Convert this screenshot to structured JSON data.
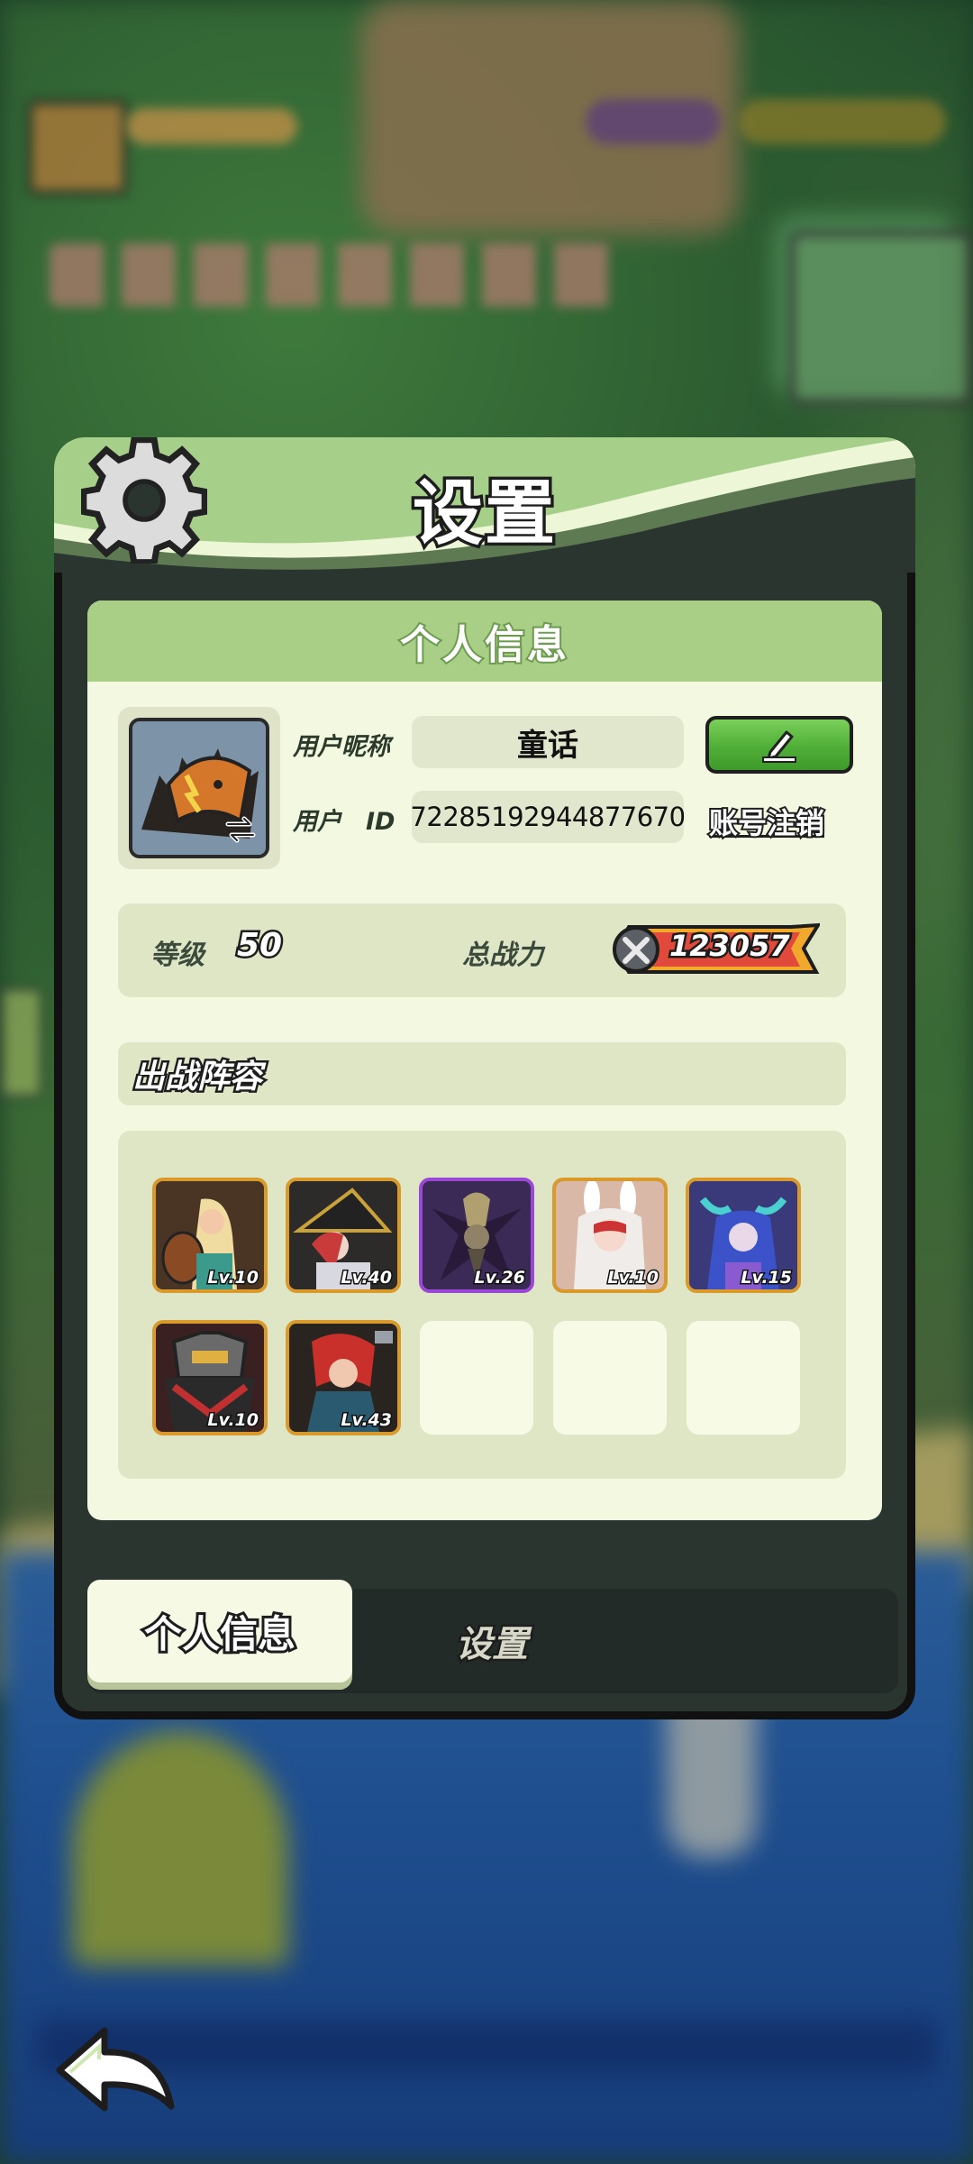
{
  "panel": {
    "title": "设置",
    "section_title": "个人信息"
  },
  "profile": {
    "nickname_label": "用户昵称",
    "nickname_value": "童话",
    "id_label": "用户　ID",
    "id_value": "72285192944877670",
    "edit_icon": "pencil-icon",
    "cancel_account_label": "账号注销"
  },
  "stats": {
    "level_label": "等级",
    "level_value": "50",
    "power_label": "总战力",
    "power_value": "123057"
  },
  "lineup": {
    "title": "出战阵容",
    "heroes": [
      {
        "level": "Lv.10"
      },
      {
        "level": "Lv.40"
      },
      {
        "level": "Lv.26"
      },
      {
        "level": "Lv.10"
      },
      {
        "level": "Lv.15"
      },
      {
        "level": "Lv.10"
      },
      {
        "level": "Lv.43"
      }
    ],
    "empty_slots": 3
  },
  "tabs": [
    {
      "label": "个人信息",
      "active": true
    },
    {
      "label": "设置",
      "active": false
    }
  ],
  "colors": {
    "header_green": "#a9cf87",
    "button_green": "#4fae37",
    "frame_gold": "#d99a2b",
    "frame_purple": "#9b47d6"
  }
}
